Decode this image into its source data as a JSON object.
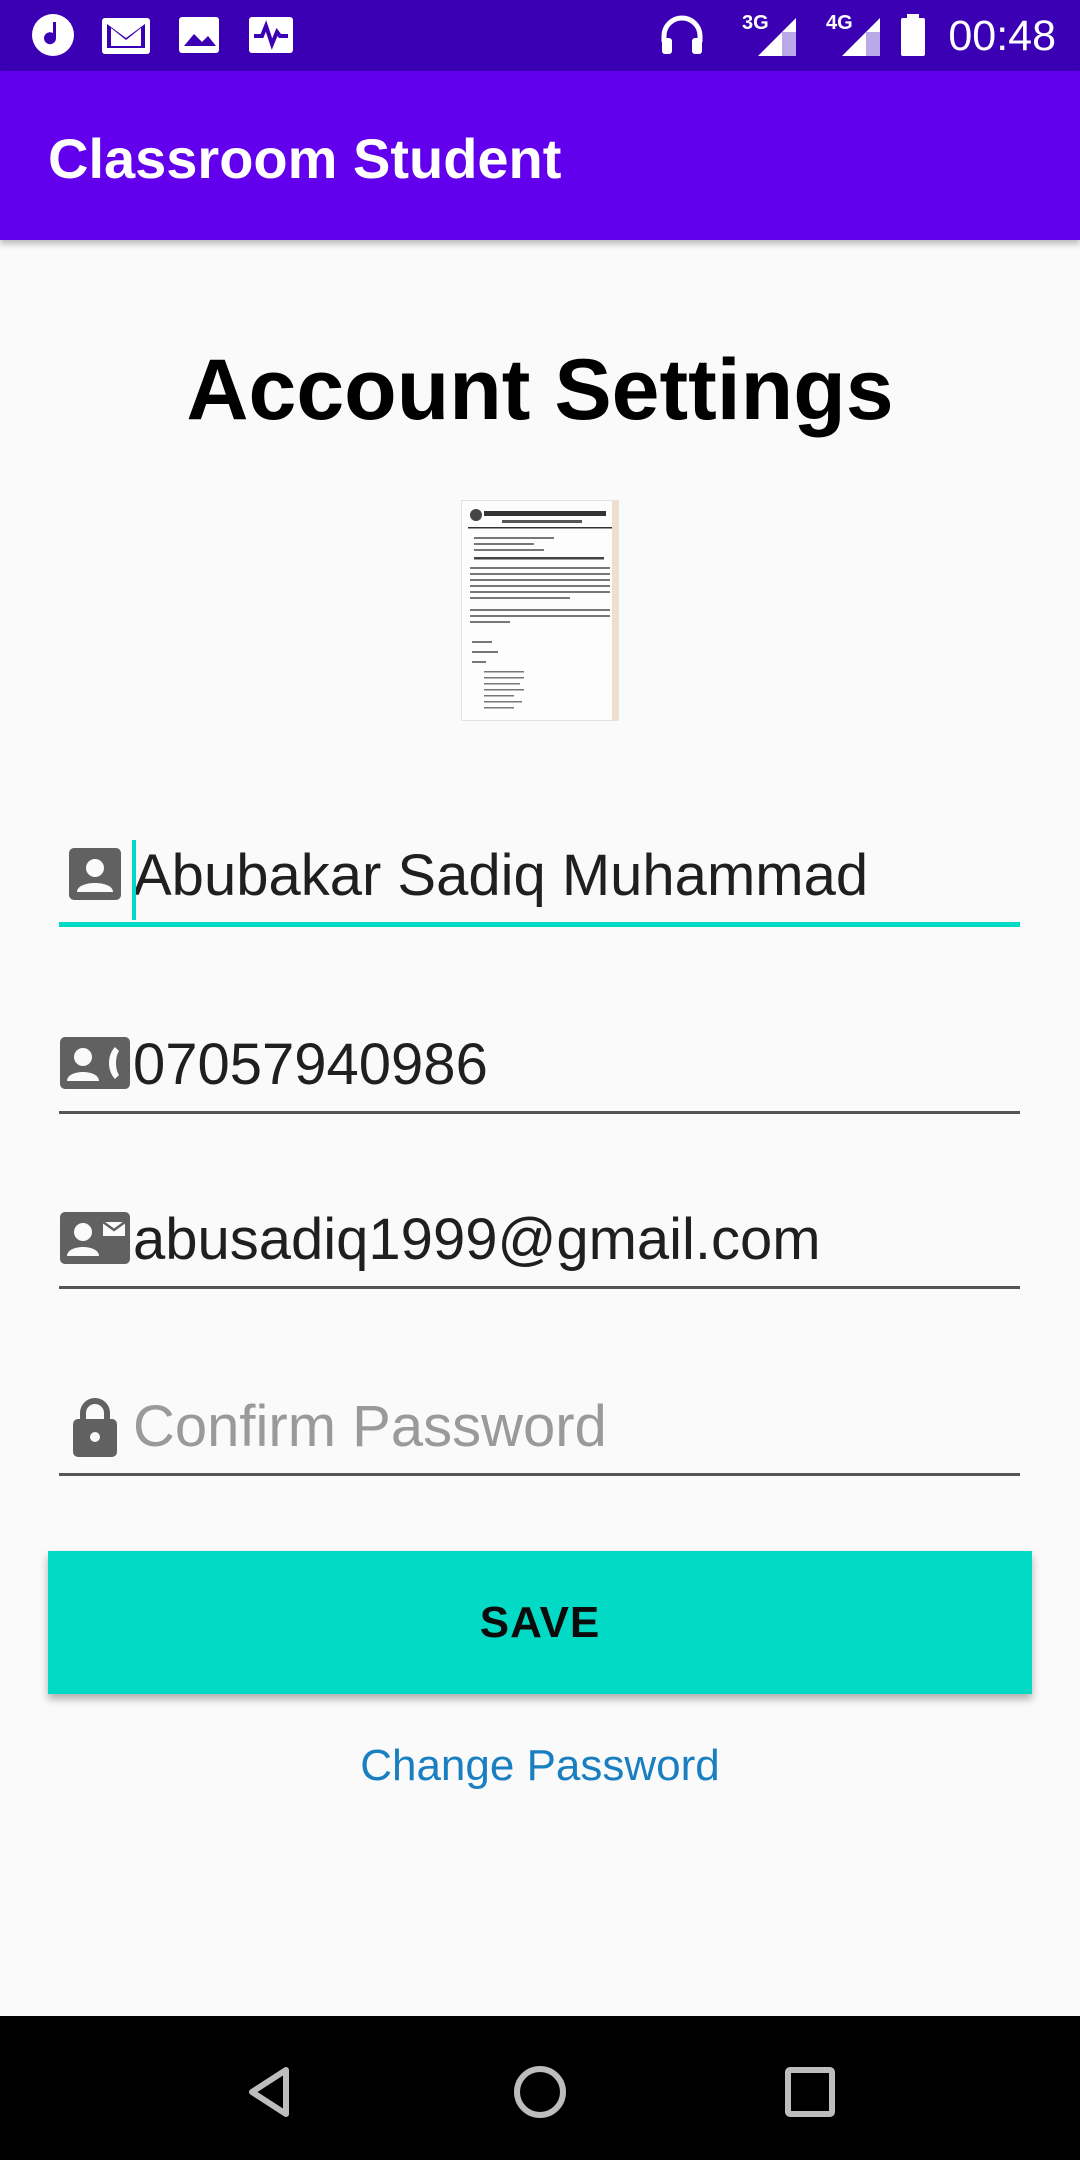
{
  "status_bar": {
    "time": "00:48",
    "network_3g": "3G",
    "network_4g": "4G",
    "icons": [
      "music-icon",
      "gmail-icon",
      "gallery-icon",
      "pulse-icon",
      "headphones-icon",
      "signal-icon",
      "signal-icon",
      "battery-icon"
    ]
  },
  "app_bar": {
    "title": "Classroom Student"
  },
  "page": {
    "title": "Account Settings"
  },
  "form": {
    "name": {
      "value": "Abubakar Sadiq Muhammad",
      "icon": "account-box-icon"
    },
    "phone": {
      "value": "07057940986",
      "icon": "contact-phone-icon"
    },
    "email": {
      "value": "abusadiq1999@gmail.com",
      "icon": "contact-mail-icon"
    },
    "confirm_password": {
      "placeholder": "Confirm Password",
      "value": "",
      "icon": "lock-icon"
    },
    "save_label": "SAVE",
    "change_password_label": "Change Password"
  },
  "colors": {
    "status_bar": "#3b00b3",
    "app_bar": "#6200ee",
    "accent": "#03dac5",
    "link": "#1a7fc1"
  },
  "nav": [
    "back-icon",
    "home-icon",
    "recents-icon"
  ]
}
